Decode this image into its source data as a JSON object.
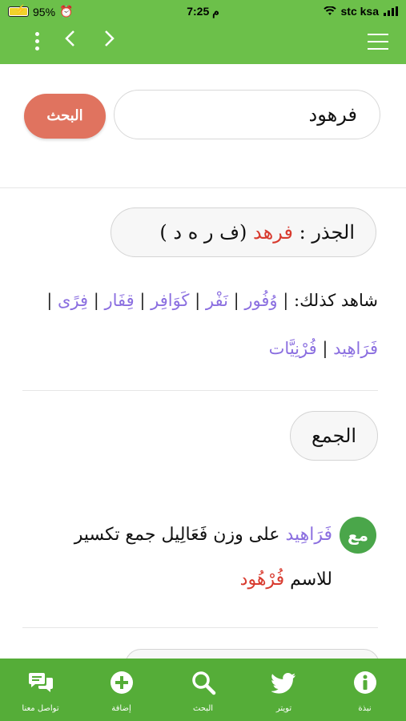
{
  "status": {
    "battery": "95%",
    "time": "7:25 م",
    "carrier": "stc ksa"
  },
  "search": {
    "value": "فرهود",
    "button_label": "البحث"
  },
  "root": {
    "label": "الجذر :",
    "word": "فرهد",
    "letters": "(ف ر ه د )"
  },
  "witness": {
    "label": "شاهد كذلك:",
    "words": [
      "وُفُور",
      "نَفْر",
      "كَوَافِر",
      "قِفَار",
      "فِرًى",
      "فَرَاهِيد",
      "فُرْنِيَّات"
    ]
  },
  "plural": {
    "label": "الجمع"
  },
  "entry": {
    "icon_text": "مع",
    "word": "فَرَاهِيد",
    "text_middle": "على وزن فَعَالِيل جمع تكسير للاسم",
    "base": "فُرْهُود"
  },
  "tabs": [
    {
      "label": "تواصل معنا",
      "icon": "chat-icon"
    },
    {
      "label": "إضافة",
      "icon": "add-icon"
    },
    {
      "label": "البحث",
      "icon": "search-icon"
    },
    {
      "label": "تويتر",
      "icon": "twitter-icon"
    },
    {
      "label": "نبذة",
      "icon": "info-icon"
    }
  ]
}
